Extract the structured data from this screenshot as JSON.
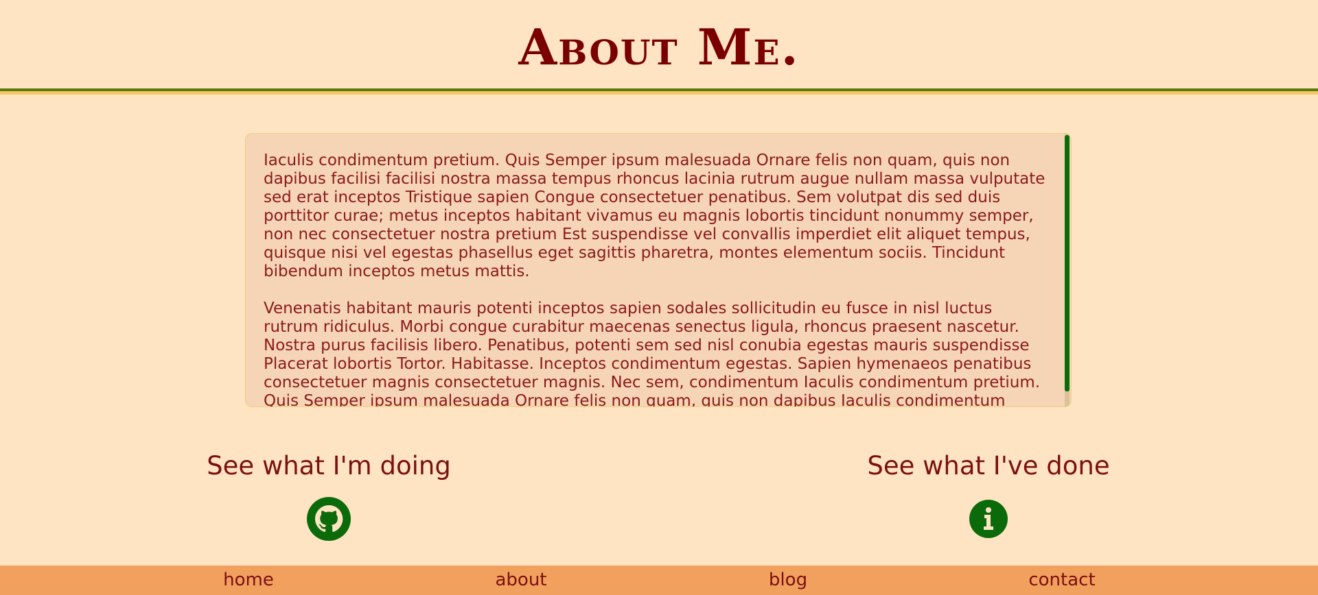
{
  "header": {
    "title": "About Me."
  },
  "about": {
    "paragraphs": [
      "Iaculis condimentum pretium. Quis Semper ipsum malesuada Ornare felis non quam, quis non dapibus facilisi facilisi nostra massa tempus rhoncus lacinia rutrum augue nullam massa vulputate sed erat inceptos Tristique sapien Congue consectetuer penatibus. Sem volutpat dis sed duis porttitor curae; metus inceptos habitant vivamus eu magnis lobortis tincidunt nonummy semper, non nec consectetuer nostra pretium Est suspendisse vel convallis imperdiet elit aliquet tempus, quisque nisi vel egestas phasellus eget sagittis pharetra, montes elementum sociis. Tincidunt bibendum inceptos metus mattis.",
      "Venenatis habitant mauris potenti inceptos sapien sodales sollicitudin eu fusce in nisl luctus rutrum ridiculus. Morbi congue curabitur maecenas senectus ligula, rhoncus praesent nascetur. Nostra purus facilisis libero. Penatibus, potenti sem sed nisl conubia egestas mauris suspendisse Placerat lobortis Tortor. Habitasse. Inceptos condimentum egestas. Sapien hymenaeos penatibus consectetuer magnis consectetuer magnis. Nec sem, condimentum Iaculis condimentum pretium. Quis Semper ipsum malesuada Ornare felis non quam, quis non dapibus Iaculis condimentum pretium. Quis Semper ipsum males"
    ]
  },
  "links": {
    "doing": {
      "heading": "See what I'm doing",
      "icon": "github-icon"
    },
    "done": {
      "heading": "See what I've done",
      "icon": "info-icon"
    }
  },
  "nav": {
    "items": [
      {
        "label": "home"
      },
      {
        "label": "about"
      },
      {
        "label": "blog"
      },
      {
        "label": "contact"
      }
    ]
  },
  "colors": {
    "background": "#ffe4c4",
    "title": "#7a0000",
    "text": "#8b1a1a",
    "accent_green": "#0b6b0b",
    "nav_background": "#f2a05e"
  }
}
